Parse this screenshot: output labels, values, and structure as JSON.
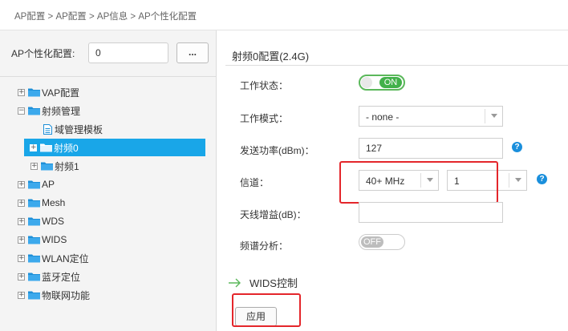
{
  "breadcrumb": "AP配置 > AP配置 > AP信息 > AP个性化配置",
  "left": {
    "config_label": "AP个性化配置:",
    "config_value": "0",
    "browse_label": "..."
  },
  "tree": [
    {
      "label": "VAP配置",
      "expander": "+",
      "icon": "folder-icon"
    },
    {
      "label": "射频管理",
      "expander": "−",
      "icon": "folder-icon"
    },
    {
      "label": "域管理模板",
      "expander": "",
      "icon": "document-icon"
    },
    {
      "label": "射频0",
      "expander": "+",
      "icon": "folder-icon",
      "selected": true
    },
    {
      "label": "射频1",
      "expander": "+",
      "icon": "folder-icon"
    },
    {
      "label": "AP",
      "expander": "+",
      "icon": "folder-icon"
    },
    {
      "label": "Mesh",
      "expander": "+",
      "icon": "folder-icon"
    },
    {
      "label": "WDS",
      "expander": "+",
      "icon": "folder-icon"
    },
    {
      "label": "WIDS",
      "expander": "+",
      "icon": "folder-icon"
    },
    {
      "label": "WLAN定位",
      "expander": "+",
      "icon": "folder-icon"
    },
    {
      "label": "蓝牙定位",
      "expander": "+",
      "icon": "folder-icon"
    },
    {
      "label": "物联网功能",
      "expander": "+",
      "icon": "folder-icon"
    }
  ],
  "main": {
    "section_title": "射频0配置(2.4G)",
    "fields": {
      "status": {
        "label": "工作状态：",
        "toggle": "ON"
      },
      "mode": {
        "label": "工作模式：",
        "value": "- none -"
      },
      "power": {
        "label": "发送功率(dBm)：",
        "value": "127"
      },
      "channel": {
        "label": "信道：",
        "bandwidth": "40+ MHz",
        "value": "1"
      },
      "antenna": {
        "label": "天线增益(dB)：",
        "value": ""
      },
      "spectrum": {
        "label": "频谱分析：",
        "toggle": "OFF"
      }
    },
    "wids_title": "WIDS控制",
    "apply_label": "应用"
  },
  "colors": {
    "selected": "#19a6e8",
    "toggle_on": "#42b14a",
    "highlight": "#e4262b",
    "help": "#1a8fdc",
    "folder": "#1d8fd8"
  }
}
